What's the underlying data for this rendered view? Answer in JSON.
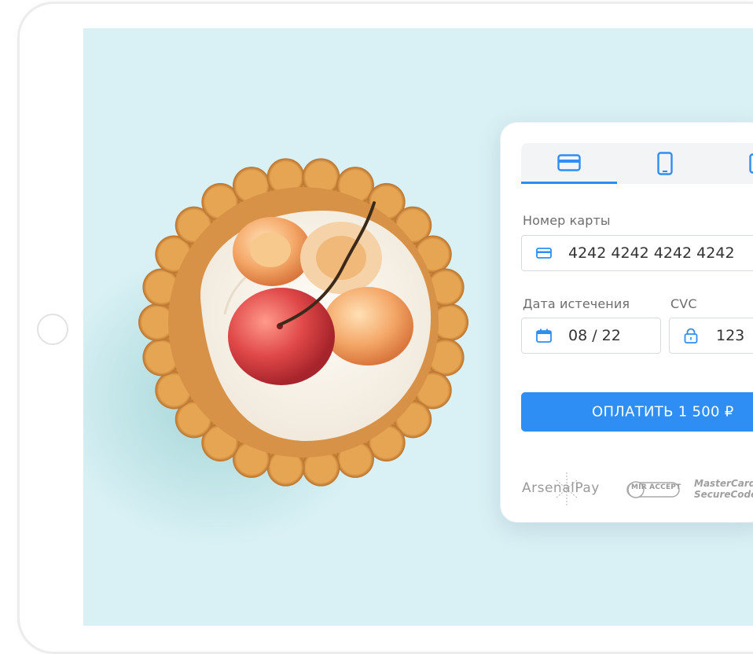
{
  "payment": {
    "tabs": [
      {
        "icon": "credit-card-icon",
        "active": true
      },
      {
        "icon": "mobile-phone-icon",
        "active": false
      },
      {
        "icon": "wallet-icon",
        "active": false
      }
    ],
    "card_number": {
      "label": "Номер карты",
      "value": "4242 4242 4242 4242"
    },
    "expiry": {
      "label": "Дата истечения",
      "value": "08 / 22"
    },
    "cvc": {
      "label": "CVC",
      "value": "123"
    },
    "pay_button": "ОПЛАТИТЬ 1 500 ₽",
    "logos": {
      "arsenal": "ArsenalPay",
      "mir": "MIR ACCEPT",
      "mastercard_line1": "MasterCard.",
      "mastercard_line2": "SecureCode."
    }
  },
  "colors": {
    "accent": "#2f8ef3",
    "screen_background": "#d9f1f5"
  }
}
